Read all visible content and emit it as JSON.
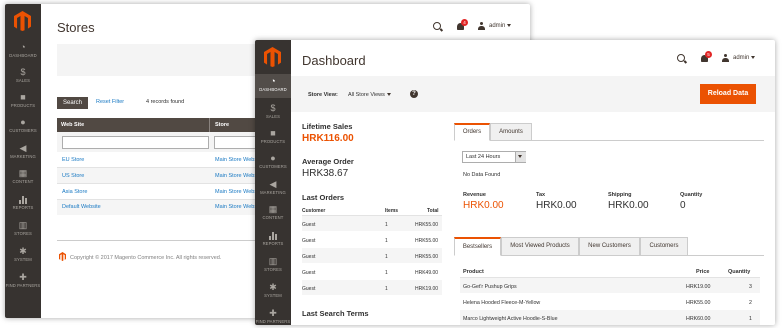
{
  "colors": {
    "accent": "#eb5202",
    "sidebar": "#373330",
    "link": "#1979c3",
    "badge": "#e22626"
  },
  "stores_window": {
    "title": "Stores",
    "notification_count": "4",
    "user": "admin",
    "sidebar": [
      {
        "label": "DASHBOARD",
        "icon": "dashboard-icon"
      },
      {
        "label": "SALES",
        "icon": "dollar-icon"
      },
      {
        "label": "PRODUCTS",
        "icon": "box-icon"
      },
      {
        "label": "CUSTOMERS",
        "icon": "person-icon"
      },
      {
        "label": "MARKETING",
        "icon": "megaphone-icon"
      },
      {
        "label": "CONTENT",
        "icon": "content-icon"
      },
      {
        "label": "REPORTS",
        "icon": "bar-chart-icon"
      },
      {
        "label": "STORES",
        "icon": "store-icon"
      },
      {
        "label": "SYSTEM",
        "icon": "gear-icon"
      },
      {
        "label": "FIND PARTNERS",
        "icon": "puzzle-icon"
      }
    ],
    "search_button": "Search",
    "reset_filter": "Reset Filter",
    "records_found": "4 records found",
    "columns": [
      "Web Site",
      "Store"
    ],
    "rows": [
      {
        "website": "EU Store",
        "store": "Main Store Webs"
      },
      {
        "website": "US Store",
        "store": "Main Store Webs"
      },
      {
        "website": "Asia Store",
        "store": "Main Store Webs"
      },
      {
        "website": "Default Website",
        "store": "Main Store Webs"
      }
    ],
    "copyright": "Copyright © 2017 Magento Commerce Inc. All rights reserved."
  },
  "dashboard_window": {
    "title": "Dashboard",
    "notification_count": "5",
    "user": "admin",
    "sidebar": [
      {
        "label": "DASHBOARD",
        "icon": "dashboard-icon"
      },
      {
        "label": "SALES",
        "icon": "dollar-icon"
      },
      {
        "label": "PRODUCTS",
        "icon": "box-icon"
      },
      {
        "label": "CUSTOMERS",
        "icon": "person-icon"
      },
      {
        "label": "MARKETING",
        "icon": "megaphone-icon"
      },
      {
        "label": "CONTENT",
        "icon": "content-icon"
      },
      {
        "label": "REPORTS",
        "icon": "bar-chart-icon"
      },
      {
        "label": "STORES",
        "icon": "store-icon"
      },
      {
        "label": "SYSTEM",
        "icon": "gear-icon"
      },
      {
        "label": "FIND PARTNERS",
        "icon": "puzzle-icon"
      }
    ],
    "store_view_label": "Store View:",
    "store_view_value": "All Store Views",
    "reload_button": "Reload Data",
    "lifetime_sales_label": "Lifetime Sales",
    "lifetime_sales_value": "HRK116.00",
    "average_order_label": "Average Order",
    "average_order_value": "HRK38.67",
    "last_orders_title": "Last Orders",
    "last_orders_columns": [
      "Customer",
      "Items",
      "Total"
    ],
    "last_orders": [
      {
        "customer": "Guest",
        "items": "1",
        "total": "HRK55.00"
      },
      {
        "customer": "Guest",
        "items": "1",
        "total": "HRK55.00"
      },
      {
        "customer": "Guest",
        "items": "1",
        "total": "HRK55.00"
      },
      {
        "customer": "Guest",
        "items": "1",
        "total": "HRK49.00"
      },
      {
        "customer": "Guest",
        "items": "1",
        "total": "HRK19.00"
      }
    ],
    "last_search_terms_title": "Last Search Terms",
    "chart_tabs": [
      "Orders",
      "Amounts"
    ],
    "period_select": "Last 24 Hours",
    "no_data": "No Data Found",
    "stats": [
      {
        "label": "Revenue",
        "value": "HRK0.00"
      },
      {
        "label": "Tax",
        "value": "HRK0.00"
      },
      {
        "label": "Shipping",
        "value": "HRK0.00"
      },
      {
        "label": "Quantity",
        "value": "0"
      }
    ],
    "product_tabs": [
      "Bestsellers",
      "Most Viewed Products",
      "New Customers",
      "Customers"
    ],
    "product_columns": [
      "Product",
      "Price",
      "Quantity"
    ],
    "products": [
      {
        "name": "Go-Get'r Pushup Grips",
        "price": "HRK19.00",
        "qty": "3"
      },
      {
        "name": "Helena Hooded Fleece-M-Yellow",
        "price": "HRK55.00",
        "qty": "2"
      },
      {
        "name": "Marco Lightweight Active Hoodie-S-Blue",
        "price": "HRK60.00",
        "qty": "1"
      }
    ]
  }
}
